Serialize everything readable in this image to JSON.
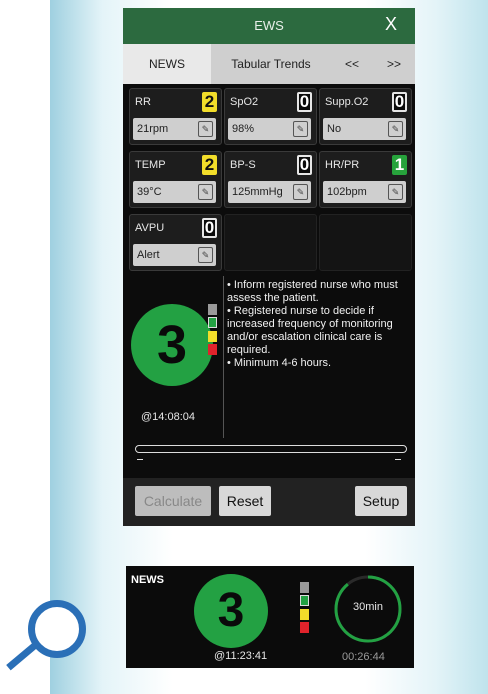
{
  "window": {
    "title": "EWS",
    "close_label": "X"
  },
  "tabs": [
    {
      "label": "NEWS",
      "active": true
    },
    {
      "label": "Tabular Trends",
      "active": false
    },
    {
      "label": "<<",
      "active": false
    },
    {
      "label": ">>",
      "active": false
    }
  ],
  "parameters": [
    {
      "name": "RR",
      "score": "2",
      "value": "21rpm"
    },
    {
      "name": "SpO2",
      "score": "0",
      "value": "98%"
    },
    {
      "name": "Supp.O2",
      "score": "0",
      "value": "No"
    },
    {
      "name": "TEMP",
      "score": "2",
      "value": "39°C"
    },
    {
      "name": "BP-S",
      "score": "0",
      "value": "125mmHg"
    },
    {
      "name": "HR/PR",
      "score": "1",
      "value": "102bpm"
    },
    {
      "name": "AVPU",
      "score": "0",
      "value": "Alert"
    }
  ],
  "total": {
    "score": "3",
    "timestamp": "@14:08:04",
    "indicator_colors": [
      "#9a9a9a",
      "#23a143",
      "#f2dd2a",
      "#e0232b"
    ]
  },
  "guidance": [
    "• Inform registered nurse who must assess the patient.",
    "• Registered nurse to decide if increased frequency of monitoring and/or escalation clinical care is required.",
    "• Minimum 4-6 hours."
  ],
  "progress": {
    "left_mark": "–",
    "right_mark": "–"
  },
  "buttons": {
    "calculate": "Calculate",
    "reset": "Reset",
    "setup": "Setup"
  },
  "mini_panel": {
    "label": "NEWS",
    "score": "3",
    "timestamp": "@11:23:41",
    "timer_label": "30min",
    "elapsed": "00:26:44",
    "timer_fraction": 0.89
  },
  "colors": {
    "accent_green": "#23a143",
    "title_bar": "#2c6a3f",
    "magnifier_blue": "#2a6fb7"
  }
}
